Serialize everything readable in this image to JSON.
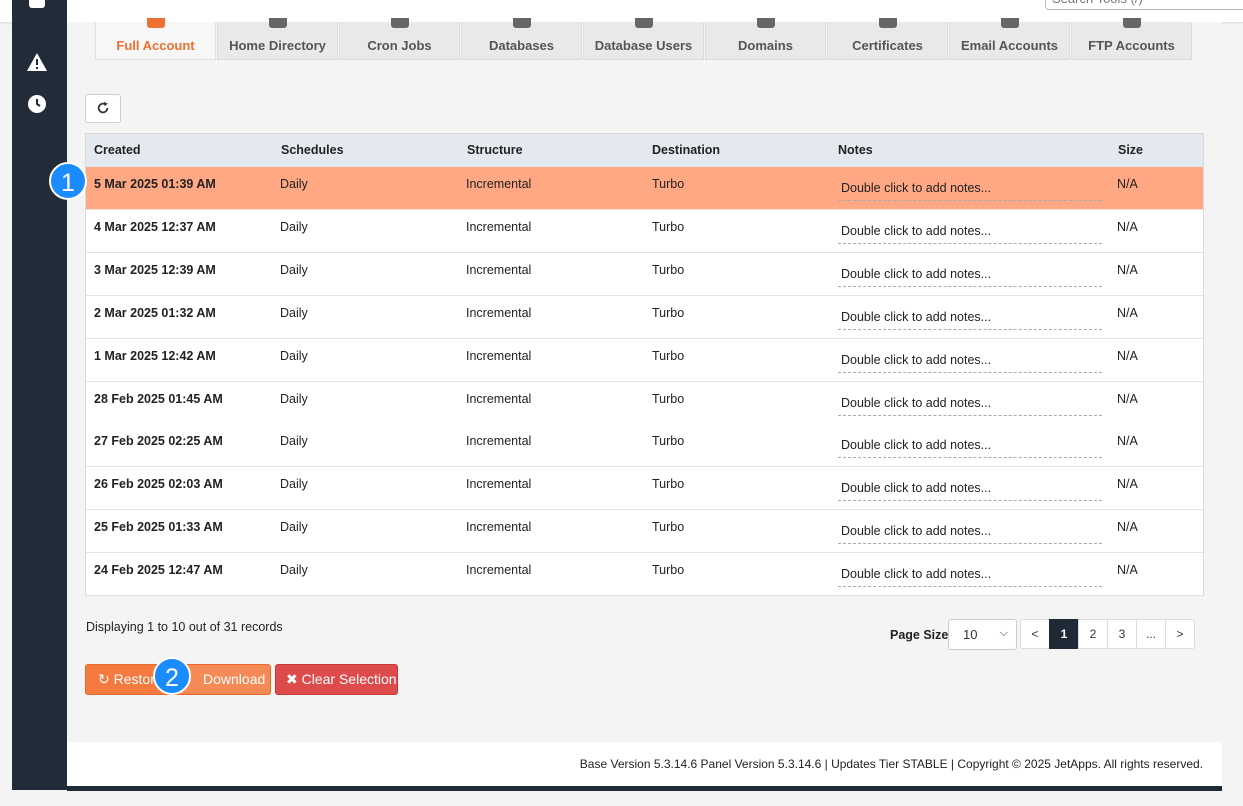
{
  "search": {
    "placeholder": "Search Tools (/)"
  },
  "tabs": [
    {
      "label": "Full Account",
      "icon": "cubes-icon",
      "active": true
    },
    {
      "label": "Home Directory",
      "icon": "folder-icon"
    },
    {
      "label": "Cron Jobs",
      "icon": "user-clock-icon"
    },
    {
      "label": "Databases",
      "icon": "database-icon"
    },
    {
      "label": "Database Users",
      "icon": "user-tie-icon"
    },
    {
      "label": "Domains",
      "icon": "map-marker-icon"
    },
    {
      "label": "Certificates",
      "icon": "certificate-icon"
    },
    {
      "label": "Email Accounts",
      "icon": "envelope-icon"
    },
    {
      "label": "FTP Accounts",
      "icon": "file-icon"
    }
  ],
  "table": {
    "columns": [
      "Created",
      "Schedules",
      "Structure",
      "Destination",
      "Notes",
      "Size"
    ],
    "rows": [
      {
        "created": "5 Mar 2025 01:39 AM",
        "schedules": "Daily",
        "structure": "Incremental",
        "destination": "Turbo",
        "notes": "Double click to add notes...",
        "size": "N/A",
        "selected": true
      },
      {
        "created": "4 Mar 2025 12:37 AM",
        "schedules": "Daily",
        "structure": "Incremental",
        "destination": "Turbo",
        "notes": "Double click to add notes...",
        "size": "N/A"
      },
      {
        "created": "3 Mar 2025 12:39 AM",
        "schedules": "Daily",
        "structure": "Incremental",
        "destination": "Turbo",
        "notes": "Double click to add notes...",
        "size": "N/A"
      },
      {
        "created": "2 Mar 2025 01:32 AM",
        "schedules": "Daily",
        "structure": "Incremental",
        "destination": "Turbo",
        "notes": "Double click to add notes...",
        "size": "N/A"
      },
      {
        "created": "1 Mar 2025 12:42 AM",
        "schedules": "Daily",
        "structure": "Incremental",
        "destination": "Turbo",
        "notes": "Double click to add notes...",
        "size": "N/A"
      },
      {
        "created": "28 Feb 2025 01:45 AM",
        "schedules": "Daily",
        "structure": "Incremental",
        "destination": "Turbo",
        "notes": "Double click to add notes...",
        "size": "N/A"
      },
      {
        "created": "27 Feb 2025 02:25 AM",
        "schedules": "Daily",
        "structure": "Incremental",
        "destination": "Turbo",
        "notes": "Double click to add notes...",
        "size": "N/A"
      },
      {
        "created": "26 Feb 2025 02:03 AM",
        "schedules": "Daily",
        "structure": "Incremental",
        "destination": "Turbo",
        "notes": "Double click to add notes...",
        "size": "N/A"
      },
      {
        "created": "25 Feb 2025 01:33 AM",
        "schedules": "Daily",
        "structure": "Incremental",
        "destination": "Turbo",
        "notes": "Double click to add notes...",
        "size": "N/A"
      },
      {
        "created": "24 Feb 2025 12:47 AM",
        "schedules": "Daily",
        "structure": "Incremental",
        "destination": "Turbo",
        "notes": "Double click to add notes...",
        "size": "N/A"
      }
    ]
  },
  "records_text": "Displaying 1 to 10 out of 31 records",
  "page_size": {
    "label": "Page Size",
    "value": "10"
  },
  "pagination": {
    "prev": "<",
    "pages": [
      "1",
      "2",
      "3"
    ],
    "ellipsis": "...",
    "next": ">",
    "current": "1"
  },
  "actions": {
    "restore": "Restore",
    "download": "Download",
    "clear": "Clear Selection"
  },
  "markers": [
    "1",
    "2"
  ],
  "footer": "Base Version 5.3.14.6 Panel Version 5.3.14.6 | Updates Tier STABLE | Copyright © 2025 JetApps. All rights reserved.",
  "colors": {
    "accent": "#f07031",
    "selected_row": "#ffa883",
    "sidebar": "#222c38",
    "danger": "#dd4b4b",
    "marker": "#1a8cff"
  }
}
